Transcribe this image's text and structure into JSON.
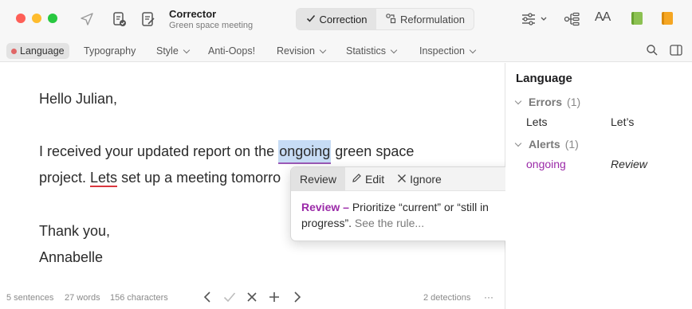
{
  "window": {
    "title": "Corrector",
    "subtitle": "Green space meeting"
  },
  "toolbar": {
    "modes": [
      {
        "label": "Correction",
        "icon": "checkmark-icon",
        "active": true
      },
      {
        "label": "Reformulation",
        "icon": "reformulation-icon",
        "active": false
      }
    ],
    "text_size_label": "AA",
    "book_colors": [
      "#8cc152",
      "#f5a623"
    ]
  },
  "tabs": [
    {
      "label": "Language",
      "active": true,
      "dot_color": "#e06666"
    },
    {
      "label": "Typography"
    },
    {
      "label": "Style",
      "dropdown": true
    },
    {
      "label": "Anti-Oops!"
    },
    {
      "label": "Revision",
      "dropdown": true
    },
    {
      "label": "Statistics",
      "dropdown": true
    },
    {
      "label": "Inspection",
      "dropdown": true
    }
  ],
  "document": {
    "greeting": "Hello Julian,",
    "para1_before": "I received your updated report on the ",
    "para1_highlight": "ongoing",
    "para1_after": " green space",
    "para2_before": "project. ",
    "para2_error": "Lets",
    "para2_after": " set up a meeting tomorro",
    "closing": "Thank you,",
    "signature": "Annabelle"
  },
  "popup": {
    "tab_review": "Review",
    "edit_label": "Edit",
    "ignore_label": "Ignore",
    "body_strong": "Review –",
    "body_text": " Prioritize “current” or “still in progress”.",
    "body_link": " See the rule..."
  },
  "status": {
    "sentences": "5 sentences",
    "words": "27 words",
    "characters": "156 characters",
    "detections": "2 detections",
    "more": "···"
  },
  "panel": {
    "title": "Language",
    "errors_label": "Errors",
    "errors_count": "(1)",
    "error_original": "Lets",
    "error_fix": "Let’s",
    "alerts_label": "Alerts",
    "alerts_count": "(1)",
    "alert_word": "ongoing",
    "alert_action": "Review"
  },
  "colors": {
    "highlight": "#c7dcf5",
    "alert_purple": "#9b2aa8",
    "error_red": "#d9363e"
  }
}
